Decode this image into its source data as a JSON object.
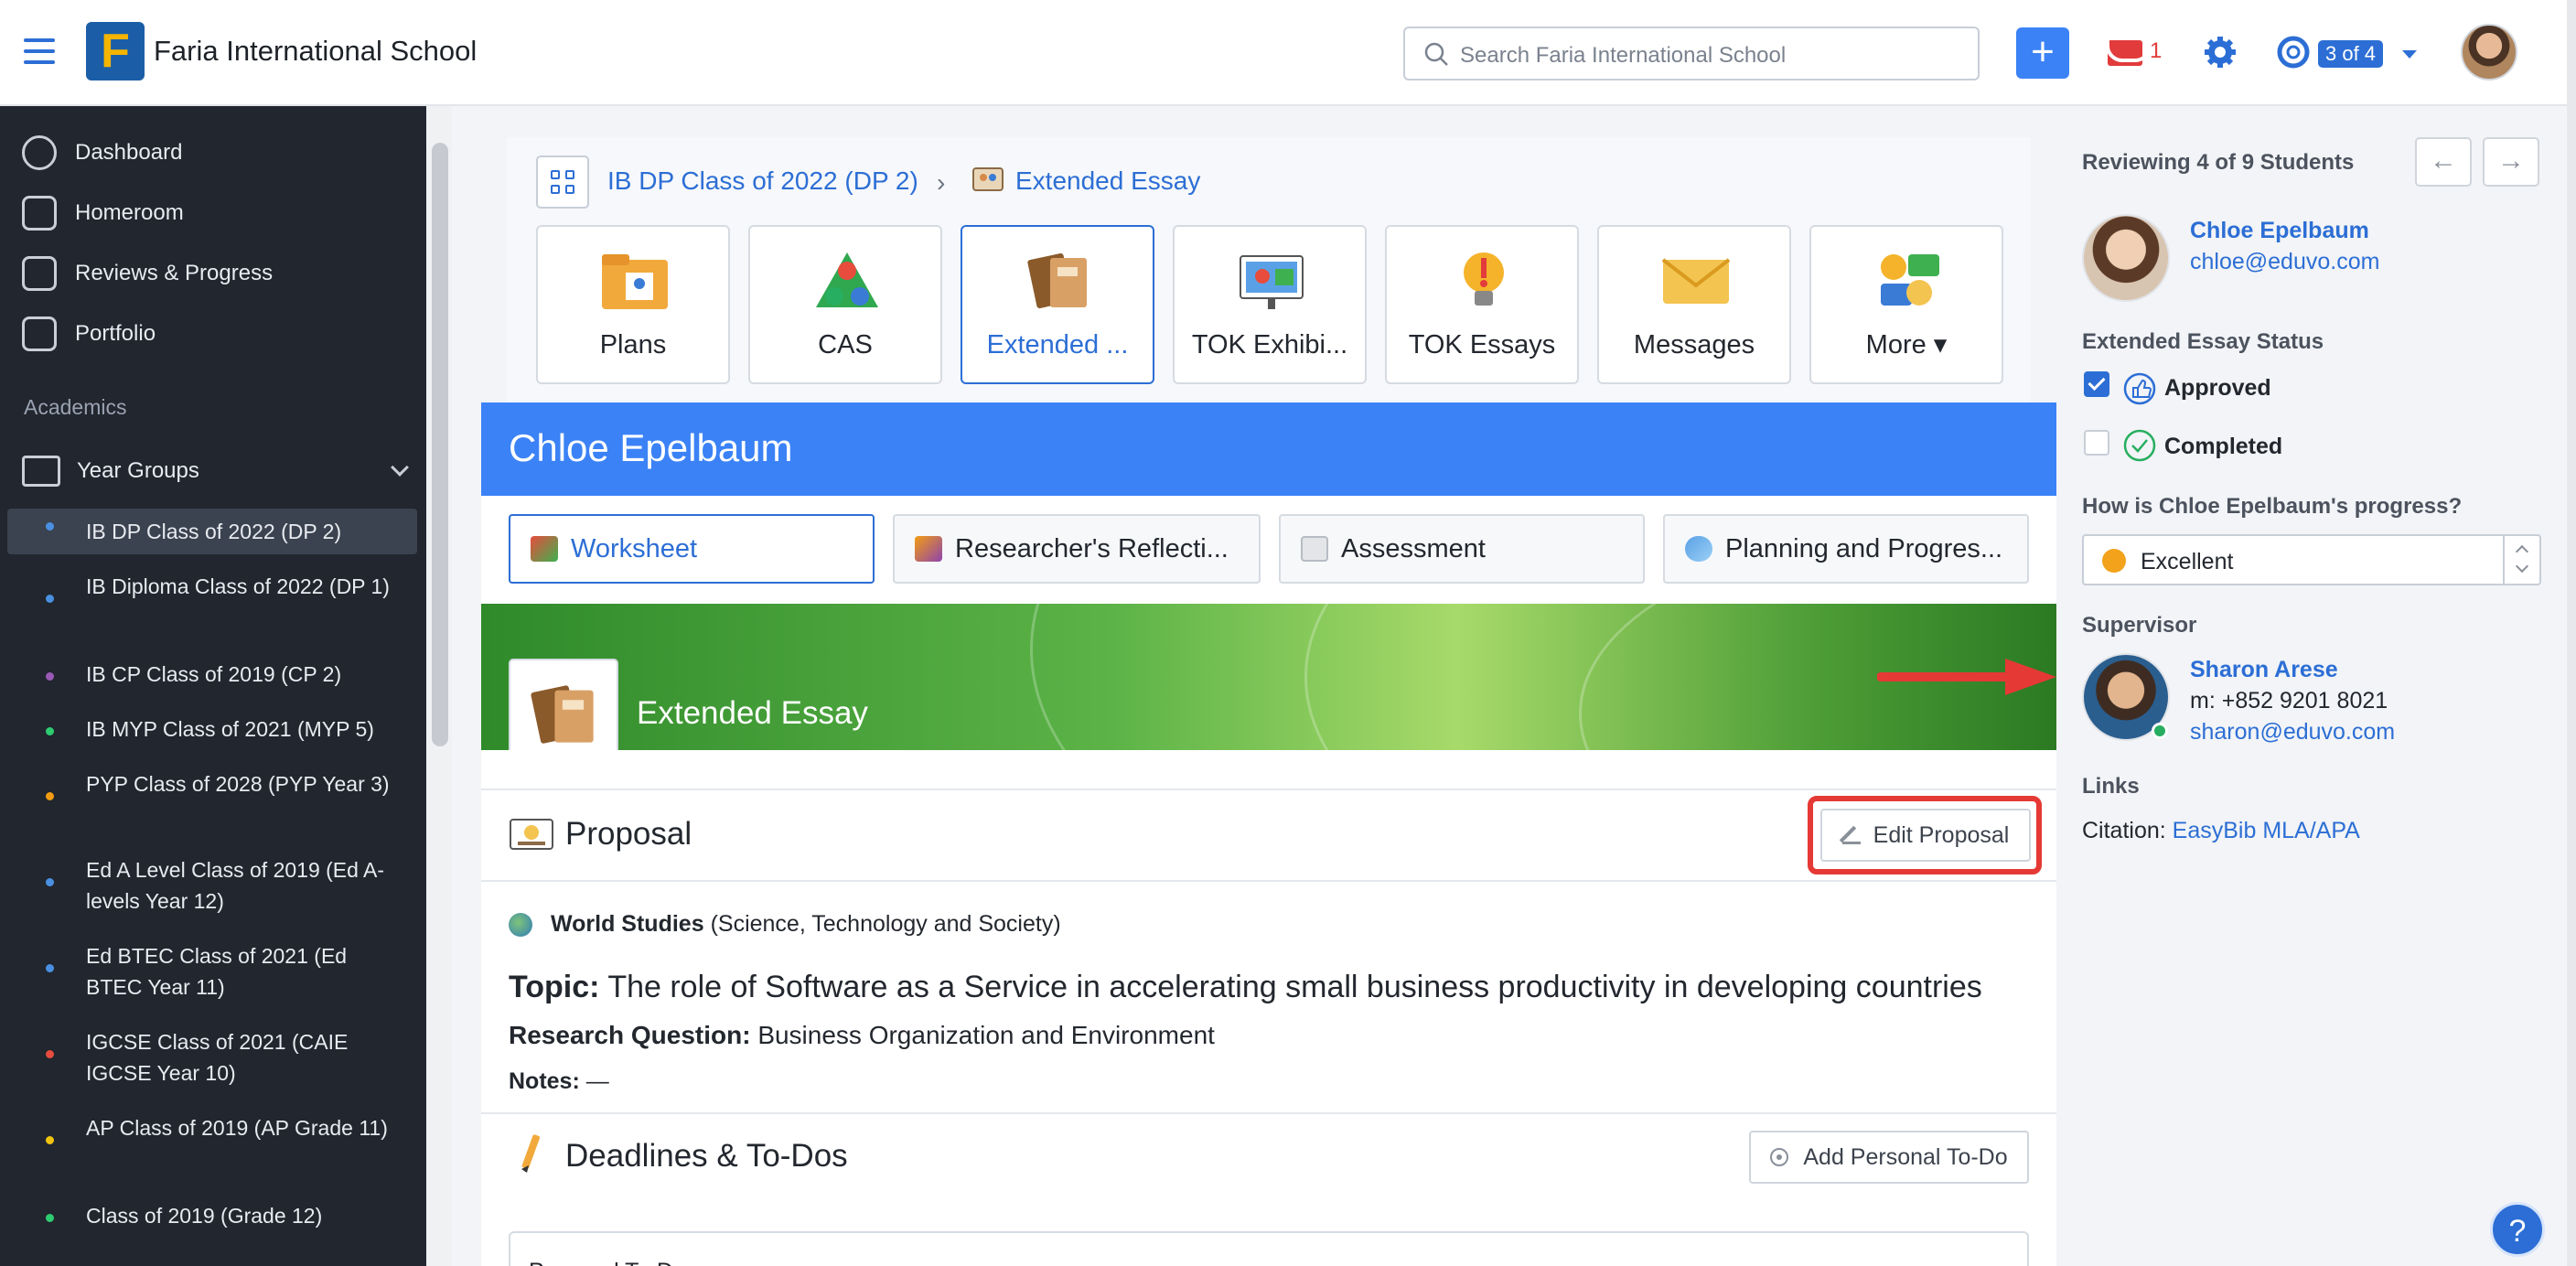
{
  "header": {
    "school_name": "Faria International School",
    "logo_letter": "F",
    "search_placeholder": "Search Faria International School",
    "mail_count": "1",
    "account_badge": "3 of 4"
  },
  "sidebar": {
    "nav": [
      {
        "label": "Dashboard",
        "icon": "dashboard-icon"
      },
      {
        "label": "Homeroom",
        "icon": "homeroom-icon"
      },
      {
        "label": "Reviews & Progress",
        "icon": "chart-line-icon"
      },
      {
        "label": "Portfolio",
        "icon": "briefcase-icon"
      }
    ],
    "section_label": "Academics",
    "year_groups_label": "Year Groups",
    "classes": [
      {
        "label": "IB DP Class of 2022 (DP 2)",
        "color": "#4a90e2"
      },
      {
        "label": "IB Diploma Class of 2022 (DP 1)",
        "color": "#4a90e2"
      },
      {
        "label": "IB CP Class of 2019 (CP 2)",
        "color": "#9b59b6"
      },
      {
        "label": "IB MYP Class of 2021 (MYP 5)",
        "color": "#2ecc71"
      },
      {
        "label": "PYP Class of 2028 (PYP Year 3)",
        "color": "#f39c12"
      },
      {
        "label": "Ed A Level Class of 2019 (Ed A-levels Year 12)",
        "color": "#4a90e2"
      },
      {
        "label": "Ed BTEC Class of 2021 (Ed BTEC Year 11)",
        "color": "#4a90e2"
      },
      {
        "label": "IGCSE Class of 2021 (CAIE IGCSE Year 10)",
        "color": "#e74c3c"
      },
      {
        "label": "AP Class of 2019 (AP Grade 11)",
        "color": "#f1c40f"
      },
      {
        "label": "Class of 2019 (Grade 12)",
        "color": "#2ecc71"
      }
    ]
  },
  "breadcrumb": {
    "class": "IB DP Class of 2022 (DP 2)",
    "separator": "›",
    "current": "Extended Essay"
  },
  "tiles": [
    {
      "label": "Plans"
    },
    {
      "label": "CAS"
    },
    {
      "label": "Extended ..."
    },
    {
      "label": "TOK Exhibi..."
    },
    {
      "label": "TOK Essays"
    },
    {
      "label": "Messages"
    },
    {
      "label": "More ▾"
    }
  ],
  "student": {
    "name": "Chloe Epelbaum"
  },
  "subtabs": [
    {
      "label": "Worksheet"
    },
    {
      "label": "Researcher's Reflecti..."
    },
    {
      "label": "Assessment"
    },
    {
      "label": "Planning and Progres..."
    }
  ],
  "banner": {
    "title": "Extended Essay"
  },
  "proposal": {
    "title": "Proposal",
    "edit_label": "Edit Proposal",
    "subject": "World Studies",
    "subject_detail": "(Science, Technology and Society)",
    "topic_label": "Topic:",
    "topic": "The role of Software as a Service in accelerating small business productivity in developing countries",
    "rq_label": "Research Question:",
    "rq": "Business Organization and Environment",
    "notes_label": "Notes:",
    "notes": "—"
  },
  "deadlines": {
    "title": "Deadlines & To-Dos",
    "add_label": "Add Personal To-Do",
    "box_title": "Personal To-Dos"
  },
  "review": {
    "title": "Reviewing 4 of 9 Students",
    "prev": "←",
    "next": "→",
    "student_name": "Chloe Epelbaum",
    "student_email": "chloe@eduvo.com",
    "status_label": "Extended Essay Status",
    "approved": "Approved",
    "completed": "Completed",
    "progress_question": "How is Chloe Epelbaum's progress?",
    "progress_value": "Excellent",
    "supervisor_label": "Supervisor",
    "supervisor_name": "Sharon Arese",
    "supervisor_phone": "m: +852 9201 8021",
    "supervisor_email": "sharon@eduvo.com",
    "links_label": "Links",
    "citation_label": "Citation:",
    "citation_link": "EasyBib MLA/APA"
  },
  "help": "?"
}
